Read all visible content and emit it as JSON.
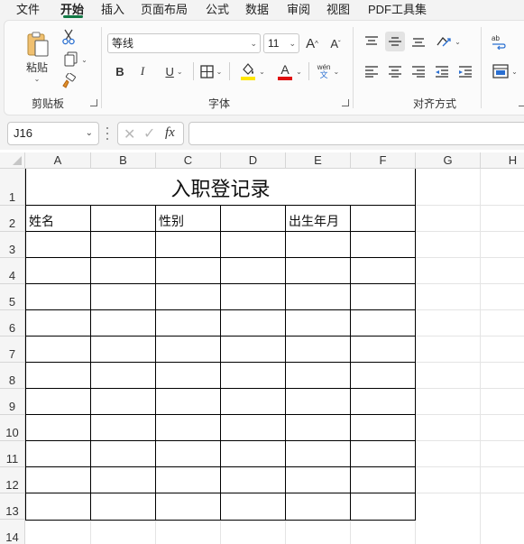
{
  "menu": {
    "tabs": [
      {
        "label": "文件",
        "active": false
      },
      {
        "label": "开始",
        "active": true
      },
      {
        "label": "插入",
        "active": false
      },
      {
        "label": "页面布局",
        "active": false
      },
      {
        "label": "公式",
        "active": false
      },
      {
        "label": "数据",
        "active": false
      },
      {
        "label": "审阅",
        "active": false
      },
      {
        "label": "视图",
        "active": false
      },
      {
        "label": "PDF工具集",
        "active": false
      }
    ],
    "accent": "#127a45"
  },
  "ribbon": {
    "clipboard": {
      "label": "剪贴板",
      "paste_label": "粘贴"
    },
    "font": {
      "label": "字体",
      "font_name": "等线",
      "font_size": "11",
      "bold": "B",
      "italic": "I",
      "underline": "U",
      "font_color": "#e01010",
      "fill_color": "#ffe600",
      "phonetic_top": "wén",
      "phonetic_bottom": "文"
    },
    "alignment": {
      "label": "对齐方式"
    }
  },
  "formula_bar": {
    "name_box": "J16",
    "fx": "fx",
    "formula": ""
  },
  "sheet": {
    "columns": [
      "A",
      "B",
      "C",
      "D",
      "E",
      "F",
      "G",
      "H"
    ],
    "rows": [
      "1",
      "2",
      "3",
      "4",
      "5",
      "6",
      "7",
      "8",
      "9",
      "10",
      "11",
      "12",
      "13",
      "14"
    ],
    "title": "入职登记录",
    "cells": {
      "A2": "姓名",
      "C2": "性别",
      "E2": "出生年月"
    }
  }
}
